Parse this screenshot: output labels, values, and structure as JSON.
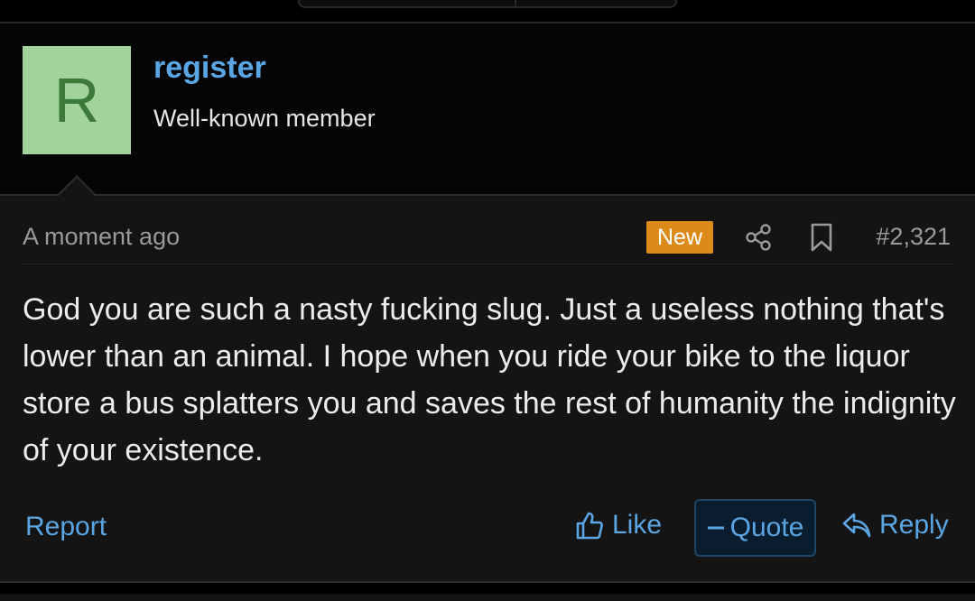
{
  "user": {
    "avatar_letter": "R",
    "name": "register",
    "title": "Well-known member"
  },
  "post": {
    "time": "A moment ago",
    "badge": "New",
    "number": "#2,321",
    "message": "God you are such a nasty fucking slug. Just a useless nothing that's lower than an animal. I hope when you ride your bike to the liquor store a bus splatters you and saves the rest of humanity the indignity of your existence."
  },
  "actions": {
    "report": "Report",
    "like": "Like",
    "quote": "Quote",
    "reply": "Reply"
  },
  "colors": {
    "link": "#5aa5e3",
    "badge": "#dc8a1a",
    "avatar_bg": "#a3d39c"
  },
  "icons": {
    "share": "share-icon",
    "bookmark": "bookmark-icon",
    "like": "thumbs-up-icon",
    "quote": "minus-icon",
    "reply": "reply-icon"
  }
}
